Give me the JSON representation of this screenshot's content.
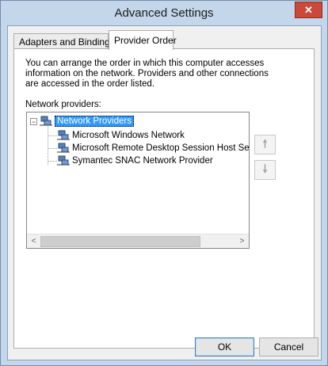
{
  "window": {
    "title": "Advanced Settings",
    "close_glyph": "✕"
  },
  "tabs": [
    {
      "label": "Adapters and Bindings",
      "active": false
    },
    {
      "label": "Provider Order",
      "active": true
    }
  ],
  "description": "You can arrange the order in which this computer accesses information on the network.  Providers and other connections are accessed in the order listed.",
  "providers_label": "Network providers:",
  "tree": {
    "root": {
      "label": "Network Providers",
      "expander": "−",
      "icon": "network-icon"
    },
    "children": [
      {
        "label": "Microsoft Windows Network",
        "icon": "network-icon"
      },
      {
        "label": "Microsoft Remote Desktop Session Host Server Network",
        "icon": "network-icon"
      },
      {
        "label": "Symantec SNAC Network Provider",
        "icon": "network-icon"
      }
    ]
  },
  "scrollbar": {
    "left_glyph": "<",
    "right_glyph": ">"
  },
  "move_up": {
    "icon": "arrow-up-icon",
    "glyph": "🠕"
  },
  "move_down": {
    "icon": "arrow-down-icon",
    "glyph": "🠗"
  },
  "buttons": {
    "ok": "OK",
    "cancel": "Cancel"
  },
  "colors": {
    "selection": "#3399ff",
    "title_bar": "#c3d6ea",
    "close": "#c94a3a"
  }
}
